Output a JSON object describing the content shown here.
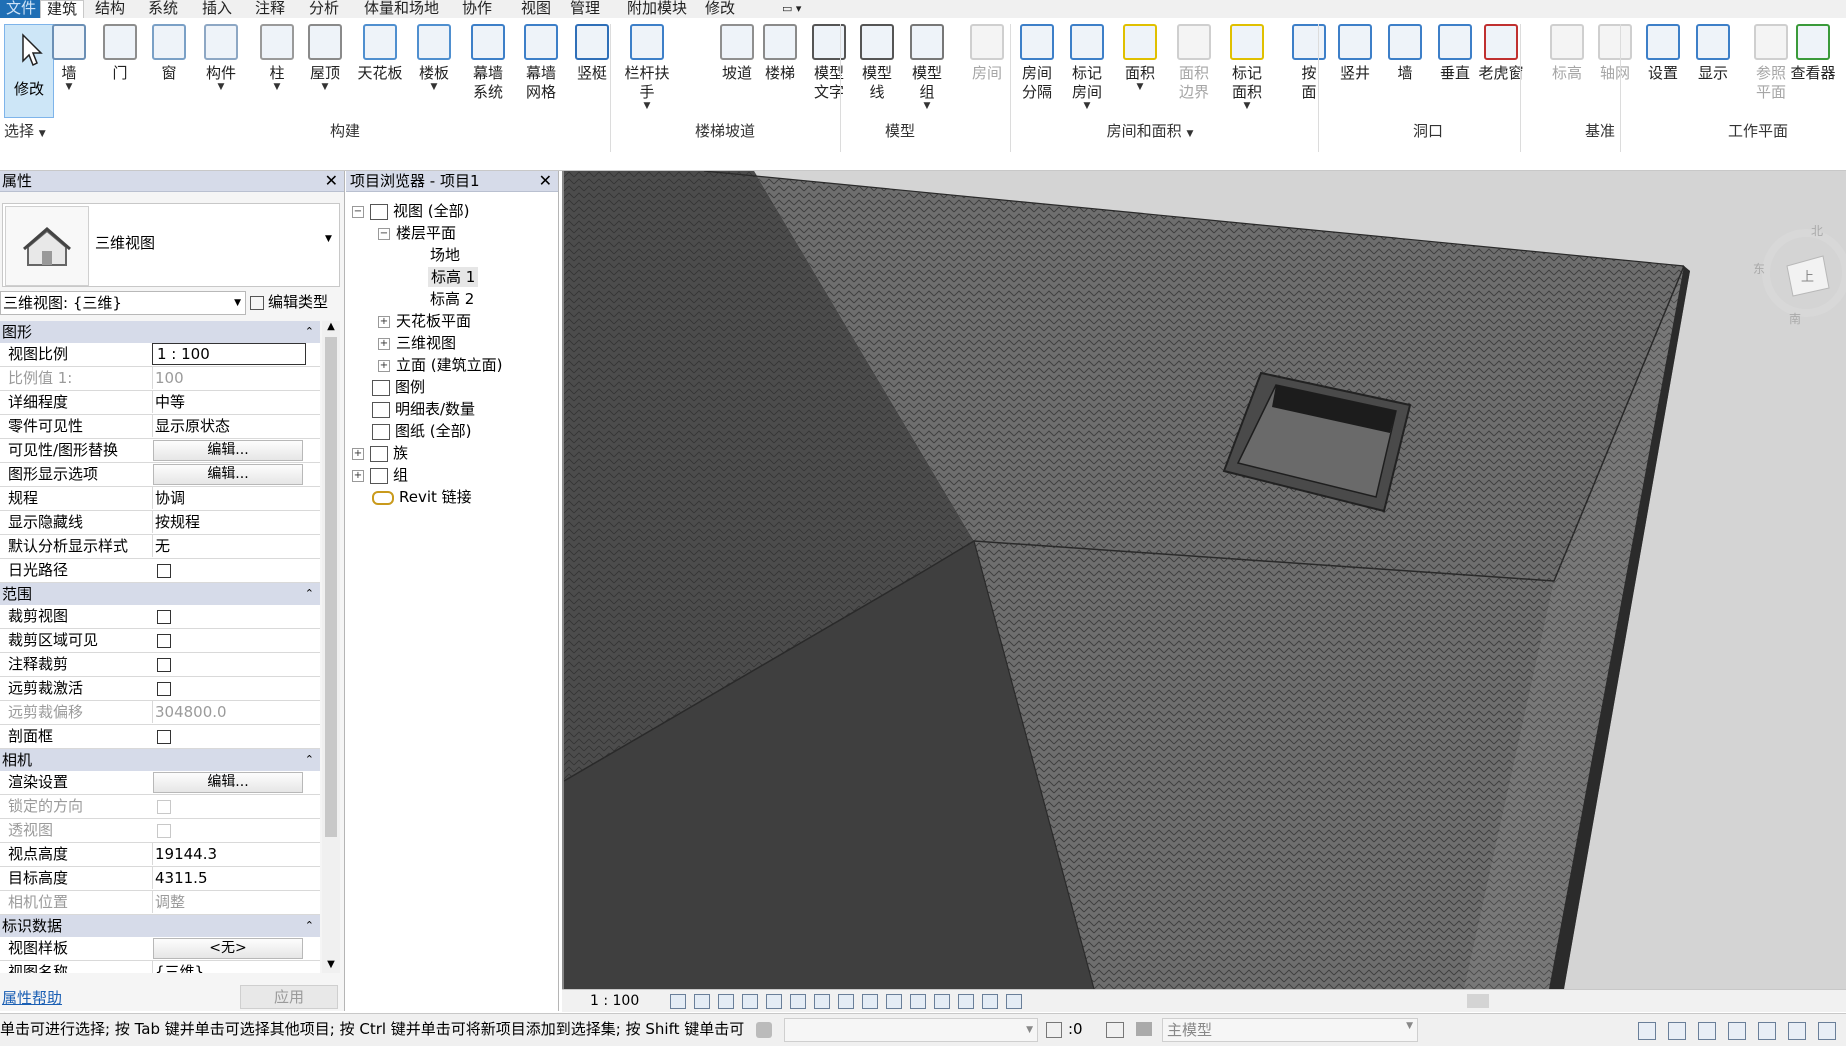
{
  "menu": {
    "tabs": [
      "文件",
      "建筑",
      "结构",
      "系统",
      "插入",
      "注释",
      "分析",
      "体量和场地",
      "协作",
      "视图",
      "管理",
      "附加模块",
      "修改"
    ],
    "active": "建筑"
  },
  "ribbon": {
    "modify": "修改",
    "select_label": "选择",
    "groups": {
      "build": "构建",
      "stairs": "楼梯坡道",
      "model": "模型",
      "room": "房间和面积",
      "opening": "洞口",
      "datum": "基准",
      "workplane": "工作平面"
    },
    "tools": [
      {
        "l1": "墙",
        "l2": "",
        "arrow": true
      },
      {
        "l1": "门",
        "l2": ""
      },
      {
        "l1": "窗",
        "l2": ""
      },
      {
        "l1": "构件",
        "l2": "",
        "arrow": true
      },
      {
        "l1": "柱",
        "l2": "",
        "arrow": true
      },
      {
        "l1": "屋顶",
        "l2": "",
        "arrow": true
      },
      {
        "l1": "天花板",
        "l2": ""
      },
      {
        "l1": "楼板",
        "l2": "",
        "arrow": true
      },
      {
        "l1": "幕墙",
        "l2": "系统"
      },
      {
        "l1": "幕墙",
        "l2": "网格"
      },
      {
        "l1": "竖梃",
        "l2": ""
      },
      {
        "l1": "栏杆扶手",
        "l2": "",
        "arrow": true
      },
      {
        "l1": "坡道",
        "l2": ""
      },
      {
        "l1": "楼梯",
        "l2": ""
      },
      {
        "l1": "模型",
        "l2": "文字"
      },
      {
        "l1": "模型",
        "l2": "线"
      },
      {
        "l1": "模型",
        "l2": "组",
        "arrow": true
      },
      {
        "l1": "房间",
        "l2": "",
        "disabled": true
      },
      {
        "l1": "房间",
        "l2": "分隔"
      },
      {
        "l1": "标记",
        "l2": "房间",
        "arrow": true
      },
      {
        "l1": "面积",
        "l2": "",
        "arrow": true
      },
      {
        "l1": "面积",
        "l2": "边界",
        "disabled": true
      },
      {
        "l1": "标记",
        "l2": "面积",
        "arrow": true
      },
      {
        "l1": "按",
        "l2": "面"
      },
      {
        "l1": "竖井",
        "l2": ""
      },
      {
        "l1": "墙",
        "l2": ""
      },
      {
        "l1": "垂直",
        "l2": ""
      },
      {
        "l1": "老虎窗",
        "l2": ""
      },
      {
        "l1": "标高",
        "l2": "",
        "disabled": true
      },
      {
        "l1": "轴网",
        "l2": "",
        "disabled": true
      },
      {
        "l1": "设置",
        "l2": ""
      },
      {
        "l1": "显示",
        "l2": ""
      },
      {
        "l1": "参照",
        "l2": "平面",
        "disabled": true
      },
      {
        "l1": "查看器",
        "l2": ""
      }
    ]
  },
  "properties": {
    "title": "属性",
    "type_name": "三维视图",
    "instance_selector": "三维视图: {三维}",
    "edit_type": "编辑类型",
    "help": "属性帮助",
    "apply": "应用",
    "sections": {
      "graphics": "图形",
      "extents": "范围",
      "camera": "相机",
      "identity": "标识数据"
    },
    "rows": {
      "view_scale": {
        "k": "视图比例",
        "v": "1 : 100"
      },
      "scale_value": {
        "k": "比例值 1:",
        "v": "100"
      },
      "detail_level": {
        "k": "详细程度",
        "v": "中等"
      },
      "parts_visibility": {
        "k": "零件可见性",
        "v": "显示原状态"
      },
      "vg_overrides": {
        "k": "可见性/图形替换",
        "v": "编辑..."
      },
      "graphic_display": {
        "k": "图形显示选项",
        "v": "编辑..."
      },
      "discipline": {
        "k": "规程",
        "v": "协调"
      },
      "show_hidden": {
        "k": "显示隐藏线",
        "v": "按规程"
      },
      "analysis_style": {
        "k": "默认分析显示样式",
        "v": "无"
      },
      "sun_path": {
        "k": "日光路径"
      },
      "crop_view": {
        "k": "裁剪视图"
      },
      "crop_visible": {
        "k": "裁剪区域可见"
      },
      "annotation_crop": {
        "k": "注释裁剪"
      },
      "far_clip": {
        "k": "远剪裁激活"
      },
      "far_offset": {
        "k": "远剪裁偏移",
        "v": "304800.0"
      },
      "section_box": {
        "k": "剖面框"
      },
      "render_settings": {
        "k": "渲染设置",
        "v": "编辑..."
      },
      "locked_orientation": {
        "k": "锁定的方向"
      },
      "perspective": {
        "k": "透视图"
      },
      "eye_elevation": {
        "k": "视点高度",
        "v": "19144.3"
      },
      "target_elevation": {
        "k": "目标高度",
        "v": "4311.5"
      },
      "camera_position": {
        "k": "相机位置",
        "v": "调整"
      },
      "view_template": {
        "k": "视图样板",
        "v": "<无>"
      },
      "view_name": {
        "k": "视图名称",
        "v": "{三维}"
      }
    }
  },
  "browser": {
    "title": "项目浏览器 - 项目1",
    "items": {
      "views": "视图 (全部)",
      "floor_plans": "楼层平面",
      "site": "场地",
      "level1": "标高 1",
      "level2": "标高 2",
      "ceiling": "天花板平面",
      "threed": "三维视图",
      "elevations": "立面 (建筑立面)",
      "legends": "图例",
      "schedules": "明细表/数量",
      "sheets": "图纸 (全部)",
      "families": "族",
      "groups": "组",
      "links": "Revit 链接"
    }
  },
  "viewcube": {
    "face": "上",
    "north": "北",
    "east": "东",
    "south": "南"
  },
  "viewbar": {
    "scale": "1 : 100"
  },
  "status": {
    "message": "单击可进行选择; 按 Tab 键并单击可选择其他项目; 按 Ctrl 键并单击可将新项目添加到选择集; 按 Shift 键单击可",
    "count": ":0",
    "model": "主模型"
  }
}
